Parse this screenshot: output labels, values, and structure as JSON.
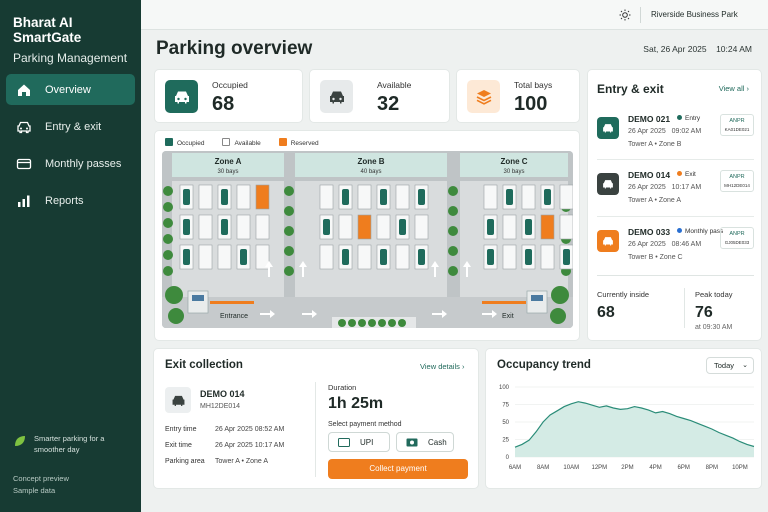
{
  "brand": {
    "name": "Bharat AI SmartGate",
    "subtitle": "Parking Management"
  },
  "nav": [
    {
      "label": "Overview",
      "icon": "home-icon",
      "active": true
    },
    {
      "label": "Entry & exit",
      "icon": "car-icon",
      "active": false
    },
    {
      "label": "Monthly passes",
      "icon": "card-icon",
      "active": false
    },
    {
      "label": "Reports",
      "icon": "bar-chart-icon",
      "active": false
    }
  ],
  "sidebar_footer": {
    "tagline": "Smarter parking for a smoother day",
    "note1": "Concept preview",
    "note2": "Sample data"
  },
  "topbar": {
    "location": "Riverside Business Park"
  },
  "page": {
    "title": "Parking overview",
    "date": "Sat, 26 Apr 2025",
    "time": "10:24 AM"
  },
  "stats": [
    {
      "label": "Occupied",
      "value": "68",
      "color": "#1f6b5c"
    },
    {
      "label": "Available",
      "value": "32",
      "color": "#e7eaeb"
    },
    {
      "label": "Total bays",
      "value": "100",
      "color": "#fde9d6"
    }
  ],
  "legend": [
    {
      "label": "Occupied",
      "color": "#1f6b5c"
    },
    {
      "label": "Available",
      "color": "#ffffff"
    },
    {
      "label": "Reserved",
      "color": "#ef7d1e"
    }
  ],
  "zones": [
    {
      "name": "Zone A",
      "bays": "30 bays"
    },
    {
      "name": "Zone B",
      "bays": "40 bays"
    },
    {
      "name": "Zone C",
      "bays": "30 bays"
    }
  ],
  "map_labels": {
    "entrance": "Entrance",
    "exit": "Exit"
  },
  "entry_exit": {
    "title": "Entry & exit",
    "view_all": "View all",
    "items": [
      {
        "plate": "DEMO 021",
        "status": "Entry",
        "status_color": "#1f6b5c",
        "date": "26 Apr 2025",
        "time": "09:02 AM",
        "area": "Tower A • Zone B",
        "anpr": "ANPR",
        "anpr_code": "KA01DE021",
        "icon_bg": "#1f6b5c"
      },
      {
        "plate": "DEMO 014",
        "status": "Exit",
        "status_color": "#ef7d1e",
        "date": "26 Apr 2025",
        "time": "10:17 AM",
        "area": "Tower A • Zone A",
        "anpr": "ANPR",
        "anpr_code": "MH12DE014",
        "icon_bg": "#3a4240"
      },
      {
        "plate": "DEMO 033",
        "status": "Monthly pass",
        "status_color": "#2a6fd1",
        "date": "26 Apr 2025",
        "time": "08:46 AM",
        "area": "Tower B • Zone C",
        "anpr": "ANPR",
        "anpr_code": "GJ05DE033",
        "icon_bg": "#ef7d1e"
      }
    ],
    "currently_inside_label": "Currently inside",
    "currently_inside": "68",
    "peak_today_label": "Peak today",
    "peak_today": "76",
    "peak_time": "at 09:30 AM"
  },
  "exit_collection": {
    "title": "Exit collection",
    "view_details": "View details",
    "plate": "DEMO 014",
    "plate_code": "MH12DE014",
    "rows": [
      {
        "label": "Entry time",
        "value": "26 Apr 2025   08:52 AM"
      },
      {
        "label": "Exit time",
        "value": "26 Apr 2025   10:17 AM"
      },
      {
        "label": "Parking area",
        "value": "Tower A • Zone A"
      }
    ],
    "duration_label": "Duration",
    "duration": "1h 25m",
    "payment_label": "Select payment method",
    "upi": "UPI",
    "cash": "Cash",
    "collect": "Collect payment"
  },
  "trend": {
    "title": "Occupancy trend",
    "range": "Today"
  },
  "chart_data": {
    "type": "area",
    "title": "Occupancy trend",
    "xlabel": "",
    "ylabel": "",
    "ylim": [
      0,
      100
    ],
    "yticks": [
      0,
      25,
      50,
      75,
      100
    ],
    "xticks": [
      "6AM",
      "8AM",
      "10AM",
      "12PM",
      "2PM",
      "4PM",
      "6PM",
      "8PM",
      "10PM"
    ],
    "x": [
      6,
      6.5,
      7,
      7.5,
      8,
      8.5,
      9,
      9.5,
      10,
      10.5,
      11,
      11.5,
      12,
      12.5,
      13,
      13.5,
      14,
      14.5,
      15,
      15.5,
      16,
      16.5,
      17,
      17.5,
      18,
      18.5,
      19,
      19.5,
      20,
      20.5,
      21,
      21.5,
      22,
      22.5,
      23
    ],
    "series": [
      {
        "values": [
          14,
          18,
          24,
          36,
          50,
          60,
          66,
          72,
          76,
          79,
          77,
          74,
          71,
          73,
          70,
          68,
          69,
          72,
          70,
          67,
          63,
          65,
          62,
          58,
          55,
          52,
          48,
          44,
          40,
          35,
          31,
          27,
          22,
          18,
          15
        ]
      }
    ],
    "color": "#2a8c78",
    "grid": true
  }
}
